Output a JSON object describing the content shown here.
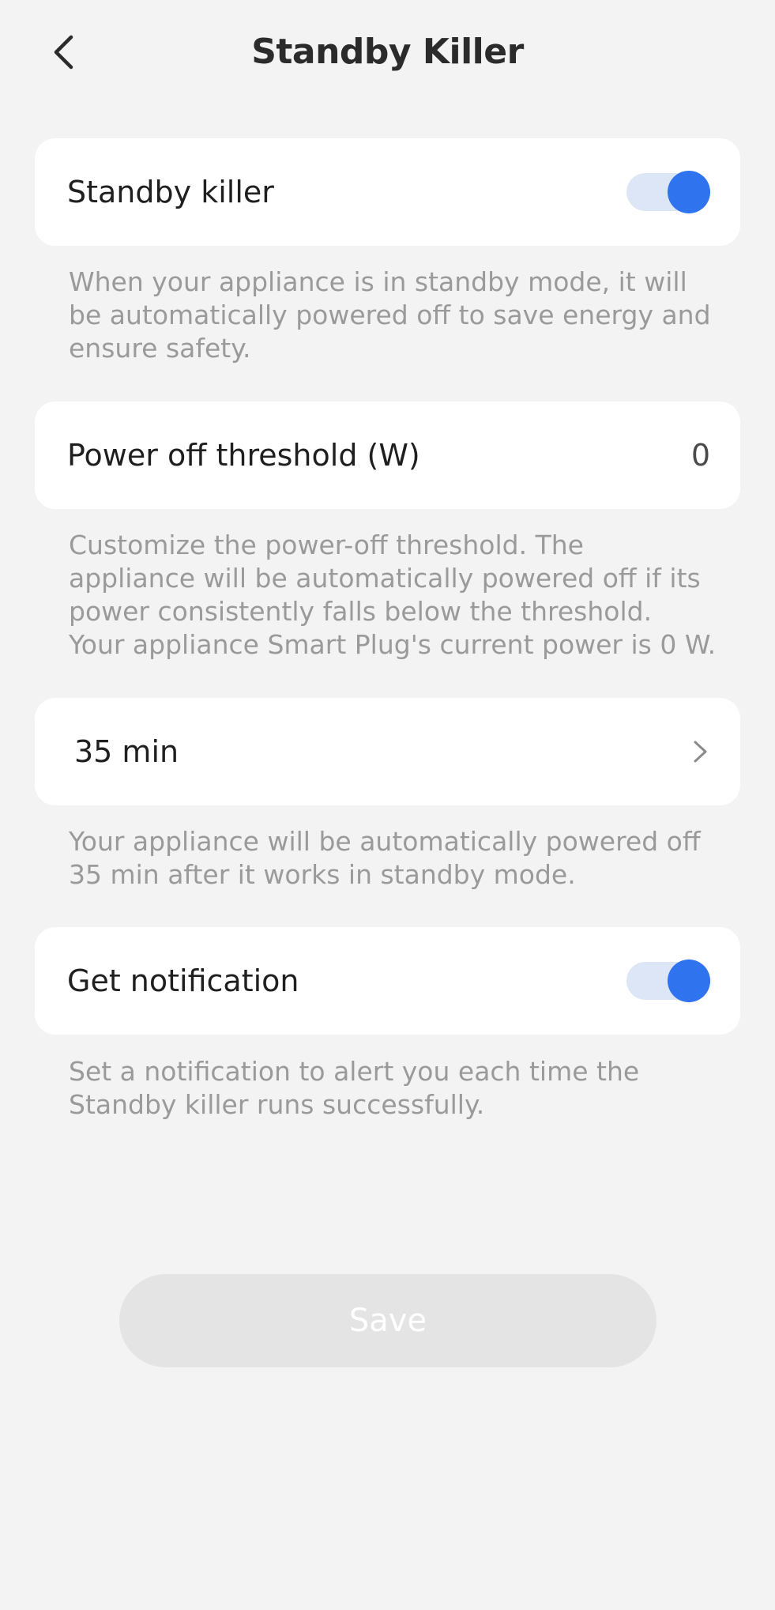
{
  "header": {
    "title": "Standby Killer",
    "back_icon": "chevron-left-icon"
  },
  "standby_killer": {
    "label": "Standby killer",
    "enabled": true,
    "description": "When your appliance is in standby mode, it will be automatically powered off to save energy and ensure safety."
  },
  "threshold": {
    "label": "Power off threshold (W)",
    "value": "0",
    "description_line1": "Customize the power-off threshold. The appliance will be automatically powered off if its power consistently falls below the threshold.",
    "description_line2": "Your appliance Smart Plug's current power is 0 W."
  },
  "delay": {
    "label": "35 min",
    "icon": "chevron-right-icon",
    "description": "Your appliance will be automatically powered off 35 min after it works in standby mode."
  },
  "notification": {
    "label": "Get notification",
    "enabled": true,
    "description": "Set a notification to alert you each time the Standby killer runs successfully."
  },
  "save": {
    "label": "Save",
    "disabled": true
  },
  "colors": {
    "accent": "#2f74ee",
    "toggle_track": "#dde6f6",
    "background": "#f3f3f3",
    "card": "#ffffff",
    "muted_text": "#9a9a9a",
    "save_disabled": "#e4e4e4"
  }
}
